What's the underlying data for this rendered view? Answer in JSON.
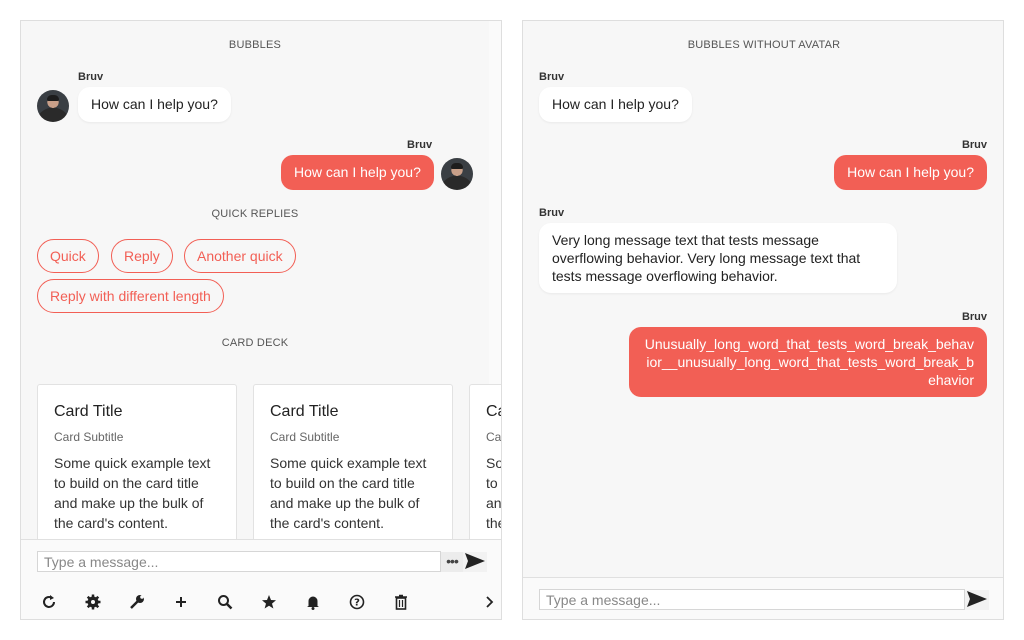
{
  "left": {
    "bubbles_title": "BUBBLES",
    "msg1": {
      "author": "Bruv",
      "text": "How can I help you?"
    },
    "msg2": {
      "author": "Bruv",
      "text": "How can I help you?"
    },
    "quick_replies_title": "QUICK REPLIES",
    "quick_replies": [
      "Quick",
      "Reply",
      "Another quick",
      "Reply with different length"
    ],
    "card_deck_title": "CARD DECK",
    "cards": [
      {
        "title": "Card Title",
        "subtitle": "Card Subtitle",
        "body": "Some quick example text to build on the card title and make up the bulk of the card's content."
      },
      {
        "title": "Card Title",
        "subtitle": "Card Subtitle",
        "body": "Some quick example text to build on the card title and make up the bulk of the card's content."
      },
      {
        "title": "Card Title",
        "subtitle": "Card Subtitle",
        "body": "Some quick example text to build on the card title and make up the bulk of the card's content."
      }
    ],
    "input_placeholder": "Type a message...",
    "more_label": "•••",
    "toolbar_icons": [
      "refresh-icon",
      "gear-icon",
      "wrench-icon",
      "plus-icon",
      "search-icon",
      "star-icon",
      "bell-icon",
      "help-icon",
      "trash-icon",
      "chevron-right-icon"
    ]
  },
  "right": {
    "bubbles_title": "BUBBLES WITHOUT AVATAR",
    "messages": [
      {
        "author": "Bruv",
        "text": "How can I help you?",
        "side": "in"
      },
      {
        "author": "Bruv",
        "text": "How can I help you?",
        "side": "out"
      },
      {
        "author": "Bruv",
        "text": "Very long message text that tests message overflowing behavior. Very long message text that tests message overflowing behavior.",
        "side": "in"
      },
      {
        "author": "Bruv",
        "text": "Unusually_long_word_that_tests_word_break_behavior__unusually_long_word_that_tests_word_break_behavior",
        "side": "out"
      }
    ],
    "input_placeholder": "Type a message..."
  },
  "colors": {
    "accent": "#f25f55",
    "panel_bg": "#f7f7f7",
    "bubble_in": "#ffffff"
  }
}
